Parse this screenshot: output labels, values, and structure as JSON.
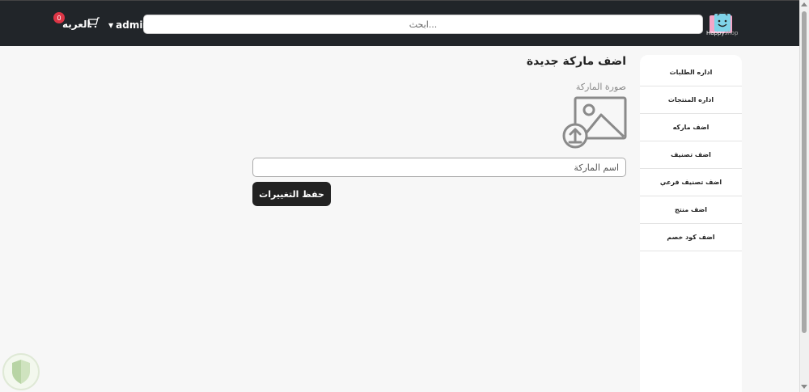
{
  "header": {
    "logo_text_main": "Happy",
    "logo_text_sub": "shop",
    "search_placeholder": "ابحث...",
    "user_name": "admin",
    "cart_label": "العربه",
    "cart_count": "0"
  },
  "sidebar": {
    "items": [
      {
        "label": "اداره الطلبات"
      },
      {
        "label": "اداره المنتجات"
      },
      {
        "label": "اضف ماركه"
      },
      {
        "label": "اضف تصنيف"
      },
      {
        "label": "اضف تصنيف فرعي"
      },
      {
        "label": "اضف منتج"
      },
      {
        "label": "اضف كود خصم"
      }
    ]
  },
  "main": {
    "title": "اضف ماركة جديدة",
    "image_label": "صورة الماركة",
    "brand_name_placeholder": "اسم الماركة",
    "save_label": "حفظ التغييرات"
  },
  "colors": {
    "navbar": "#212529",
    "badge": "#dc3545",
    "button": "#222222"
  }
}
